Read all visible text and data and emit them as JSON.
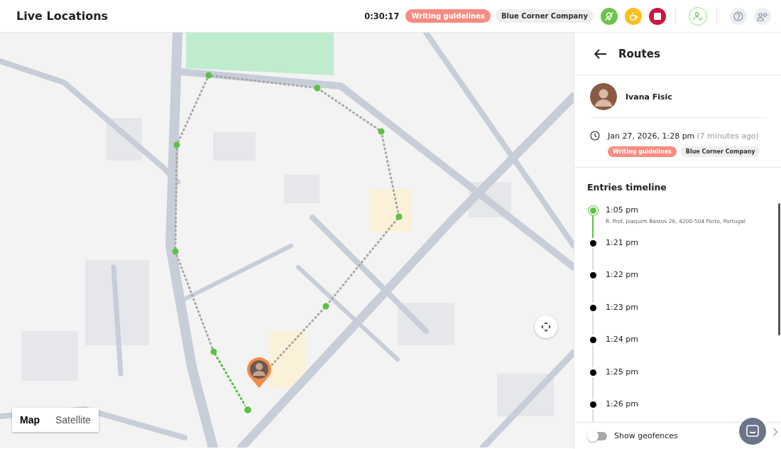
{
  "header": {
    "title": "Live Locations",
    "timer": "0:30:17",
    "tags": [
      {
        "label": "Writing guidelines",
        "color": "#f98b80"
      },
      {
        "label": "Blue Corner Company",
        "color": "#eeeeee"
      }
    ],
    "actions": [
      {
        "kind": "location_off",
        "color": "#6cc24a"
      },
      {
        "kind": "coffee",
        "color": "#fbbf1a"
      },
      {
        "kind": "stop",
        "color": "#c8193f"
      },
      {
        "kind": "user_check",
        "color": "#ffffff"
      },
      {
        "kind": "help",
        "color": "#eceef2"
      },
      {
        "kind": "user_settings",
        "color": "#eceef2"
      }
    ]
  },
  "map": {
    "view_toggle": [
      {
        "label": "Map",
        "selected": true
      },
      {
        "label": "Satellite",
        "selected": false
      }
    ]
  },
  "panel": {
    "title": "Routes",
    "user": {
      "name": "Ivana Fisic"
    },
    "datetime": "Jan 27, 2026, 1:28 pm",
    "relative": "(7 minutes ago)",
    "tags": [
      {
        "label": "Writing guidelines",
        "color": "#f98b80"
      },
      {
        "label": "Blue Corner Company",
        "color": "#eeeeee"
      }
    ],
    "timeline_title": "Entries timeline",
    "entries": [
      {
        "time": "1:05 pm",
        "address": "R. Prof. Joaquim Bastos 26, 4200-504 Porto, Portugal",
        "selected": true
      },
      {
        "time": "1:21 pm",
        "selected": false
      },
      {
        "time": "1:22 pm",
        "selected": false
      },
      {
        "time": "1:23 pm",
        "selected": false
      },
      {
        "time": "1:24 pm",
        "selected": false
      },
      {
        "time": "1:25 pm",
        "selected": false
      },
      {
        "time": "1:26 pm",
        "selected": false
      }
    ],
    "geofences": {
      "label": "Show geofences",
      "on": false
    }
  }
}
